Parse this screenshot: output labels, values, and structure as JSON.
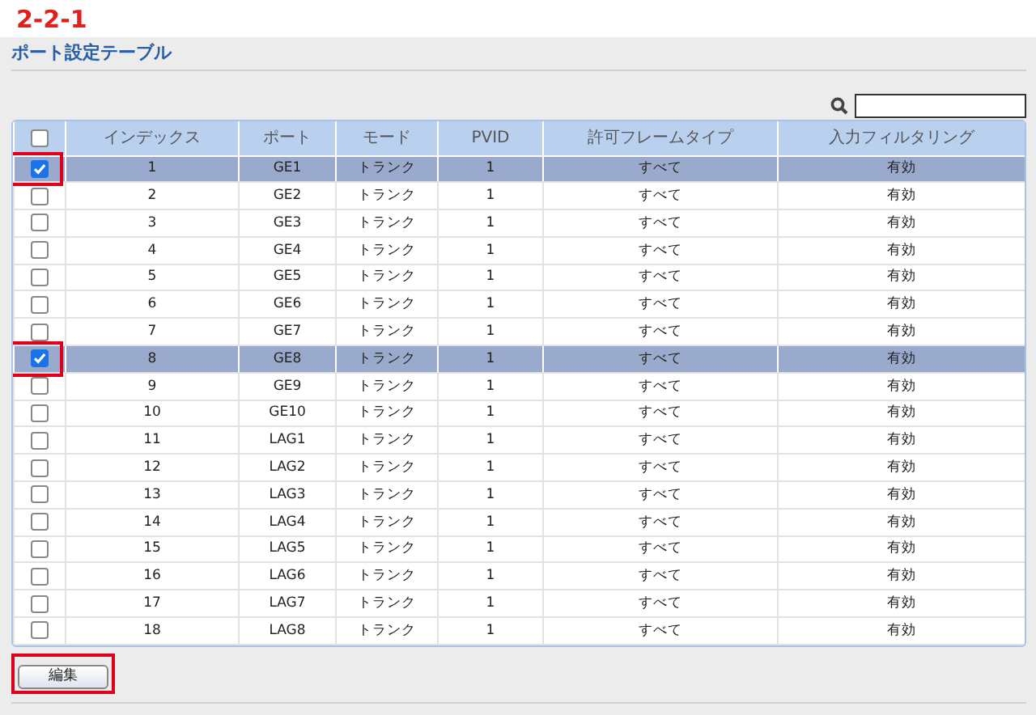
{
  "annotation_label": "2-2-1",
  "title": "ポート設定テーブル",
  "table": {
    "select_all": {
      "checked": false
    },
    "columns": [
      "インデックス",
      "ポート",
      "モード",
      "PVID",
      "許可フレームタイプ",
      "入力フィルタリング"
    ],
    "rows": [
      {
        "selected": true,
        "checked": true,
        "annotated": true,
        "cells": [
          "1",
          "GE1",
          "トランク",
          "1",
          "すべて",
          "有効"
        ]
      },
      {
        "selected": false,
        "checked": false,
        "annotated": false,
        "cells": [
          "2",
          "GE2",
          "トランク",
          "1",
          "すべて",
          "有効"
        ]
      },
      {
        "selected": false,
        "checked": false,
        "annotated": false,
        "cells": [
          "3",
          "GE3",
          "トランク",
          "1",
          "すべて",
          "有効"
        ]
      },
      {
        "selected": false,
        "checked": false,
        "annotated": false,
        "cells": [
          "4",
          "GE4",
          "トランク",
          "1",
          "すべて",
          "有効"
        ]
      },
      {
        "selected": false,
        "checked": false,
        "annotated": false,
        "cells": [
          "5",
          "GE5",
          "トランク",
          "1",
          "すべて",
          "有効"
        ]
      },
      {
        "selected": false,
        "checked": false,
        "annotated": false,
        "cells": [
          "6",
          "GE6",
          "トランク",
          "1",
          "すべて",
          "有効"
        ]
      },
      {
        "selected": false,
        "checked": false,
        "annotated": false,
        "cells": [
          "7",
          "GE7",
          "トランク",
          "1",
          "すべて",
          "有効"
        ]
      },
      {
        "selected": true,
        "checked": true,
        "annotated": true,
        "cells": [
          "8",
          "GE8",
          "トランク",
          "1",
          "すべて",
          "有効"
        ]
      },
      {
        "selected": false,
        "checked": false,
        "annotated": false,
        "cells": [
          "9",
          "GE9",
          "トランク",
          "1",
          "すべて",
          "有効"
        ]
      },
      {
        "selected": false,
        "checked": false,
        "annotated": false,
        "cells": [
          "10",
          "GE10",
          "トランク",
          "1",
          "すべて",
          "有効"
        ]
      },
      {
        "selected": false,
        "checked": false,
        "annotated": false,
        "cells": [
          "11",
          "LAG1",
          "トランク",
          "1",
          "すべて",
          "有効"
        ]
      },
      {
        "selected": false,
        "checked": false,
        "annotated": false,
        "cells": [
          "12",
          "LAG2",
          "トランク",
          "1",
          "すべて",
          "有効"
        ]
      },
      {
        "selected": false,
        "checked": false,
        "annotated": false,
        "cells": [
          "13",
          "LAG3",
          "トランク",
          "1",
          "すべて",
          "有効"
        ]
      },
      {
        "selected": false,
        "checked": false,
        "annotated": false,
        "cells": [
          "14",
          "LAG4",
          "トランク",
          "1",
          "すべて",
          "有効"
        ]
      },
      {
        "selected": false,
        "checked": false,
        "annotated": false,
        "cells": [
          "15",
          "LAG5",
          "トランク",
          "1",
          "すべて",
          "有効"
        ]
      },
      {
        "selected": false,
        "checked": false,
        "annotated": false,
        "cells": [
          "16",
          "LAG6",
          "トランク",
          "1",
          "すべて",
          "有効"
        ]
      },
      {
        "selected": false,
        "checked": false,
        "annotated": false,
        "cells": [
          "17",
          "LAG7",
          "トランク",
          "1",
          "すべて",
          "有効"
        ]
      },
      {
        "selected": false,
        "checked": false,
        "annotated": false,
        "cells": [
          "18",
          "LAG8",
          "トランク",
          "1",
          "すべて",
          "有効"
        ]
      }
    ]
  },
  "edit_button": {
    "label": "編集",
    "annotated": true
  }
}
